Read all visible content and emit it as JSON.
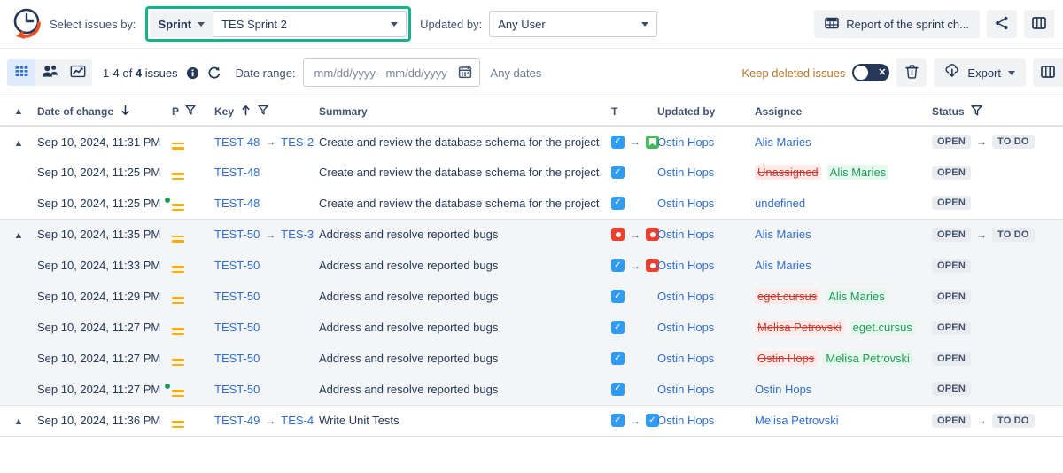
{
  "header": {
    "logo_icon": "clock-arrow-logo",
    "select_issues_label": "Select issues by:",
    "scope_segment": {
      "label": "Sprint",
      "icon": "chevron-down-icon"
    },
    "scope_value": {
      "value": "TES Sprint 2",
      "icon": "chevron-down-icon"
    },
    "updated_by_label": "Updated by:",
    "updated_by_value": {
      "value": "Any User",
      "icon": "chevron-down-icon"
    },
    "report_button": {
      "label": "Report of the sprint ch...",
      "icon": "table-grid-icon"
    },
    "share_button": {
      "icon": "share-icon"
    },
    "columns_button": {
      "icon": "columns-icon"
    },
    "highlight_color": "#16b28a"
  },
  "toolbar": {
    "views": [
      {
        "name": "grid-view",
        "icon": "grid-icon",
        "active": true
      },
      {
        "name": "people-view",
        "icon": "people-icon",
        "active": false
      },
      {
        "name": "chart-view",
        "icon": "chart-line-icon",
        "active": false
      }
    ],
    "count_prefix": "1-4",
    "count_middle": "of",
    "count_number": "4",
    "count_suffix": "issues",
    "info_icon": "info-icon",
    "refresh_icon": "refresh-icon",
    "date_range_label": "Date range:",
    "date_range_placeholder": "mm/dd/yyyy - mm/dd/yyyy",
    "calendar_icon": "calendar-icon",
    "any_dates_label": "Any dates",
    "keep_deleted_label": "Keep deleted issues",
    "keep_deleted_state": "off",
    "toggle_glyph": "✕",
    "trash_icon": "trash-icon",
    "export_button": {
      "label": "Export",
      "icon": "cloud-download-icon",
      "caret": "chevron-down-icon"
    },
    "columns_icon": "columns-icon"
  },
  "table": {
    "columns": [
      {
        "key": "expand",
        "label": "",
        "icon": "chevron-up-icon"
      },
      {
        "key": "date",
        "label": "Date of change",
        "sort_icon": "arrow-down-icon"
      },
      {
        "key": "priority",
        "label": "P",
        "filter_icon": "filter-icon"
      },
      {
        "key": "issuekey",
        "label": "Key",
        "sort_icon": "arrow-up-icon",
        "filter_icon": "filter-icon"
      },
      {
        "key": "summary",
        "label": "Summary"
      },
      {
        "key": "type",
        "label": "T"
      },
      {
        "key": "updated_by",
        "label": "Updated by"
      },
      {
        "key": "assignee",
        "label": "Assignee"
      },
      {
        "key": "status",
        "label": "Status",
        "filter_icon": "filter-icon"
      }
    ],
    "groups": [
      {
        "alt": false,
        "rows": [
          {
            "expandable": true,
            "date": "Sep 10, 2024, 11:31 PM",
            "dot": false,
            "priority": "medium",
            "key_from": "TEST-48",
            "key_to": "TES-2",
            "summary": "Create and review the database schema for the project",
            "type_from": "task",
            "type_to": "story",
            "updated_by": "Ostin Hops",
            "assignee_kind": "plain",
            "assignee": "Alis Maries",
            "status_from": "OPEN",
            "status_to": "TO DO"
          },
          {
            "expandable": false,
            "date": "Sep 10, 2024, 11:25 PM",
            "dot": false,
            "priority": "medium",
            "key_from": "TEST-48",
            "key_to": "",
            "summary": "Create and review the database schema for the project",
            "type_from": "task",
            "type_to": "",
            "updated_by": "Ostin Hops",
            "assignee_kind": "change",
            "assignee_old": "Unassigned",
            "assignee_new": "Alis Maries",
            "status_from": "OPEN",
            "status_to": ""
          },
          {
            "expandable": false,
            "date": "Sep 10, 2024, 11:25 PM",
            "dot": true,
            "priority": "medium",
            "key_from": "TEST-48",
            "key_to": "",
            "summary": "Create and review the database schema for the project",
            "type_from": "task",
            "type_to": "",
            "updated_by": "Ostin Hops",
            "assignee_kind": "link",
            "assignee": "undefined",
            "status_from": "OPEN",
            "status_to": ""
          }
        ]
      },
      {
        "alt": true,
        "rows": [
          {
            "expandable": true,
            "date": "Sep 10, 2024, 11:35 PM",
            "dot": false,
            "priority": "medium",
            "key_from": "TEST-50",
            "key_to": "TES-3",
            "summary": "Address and resolve reported bugs",
            "type_from": "bug",
            "type_to": "bug",
            "updated_by": "Ostin Hops",
            "assignee_kind": "plain",
            "assignee": "Alis Maries",
            "status_from": "OPEN",
            "status_to": "TO DO"
          },
          {
            "expandable": false,
            "date": "Sep 10, 2024, 11:33 PM",
            "dot": false,
            "priority": "medium",
            "key_from": "TEST-50",
            "key_to": "",
            "summary": "Address and resolve reported bugs",
            "type_from": "task",
            "type_to": "bug",
            "updated_by": "Ostin Hops",
            "assignee_kind": "plain",
            "assignee": "Alis Maries",
            "status_from": "OPEN",
            "status_to": ""
          },
          {
            "expandable": false,
            "date": "Sep 10, 2024, 11:29 PM",
            "dot": false,
            "priority": "medium",
            "key_from": "TEST-50",
            "key_to": "",
            "summary": "Address and resolve reported bugs",
            "type_from": "task",
            "type_to": "",
            "updated_by": "Ostin Hops",
            "assignee_kind": "change",
            "assignee_old": "eget.cursus",
            "assignee_new": "Alis Maries",
            "status_from": "OPEN",
            "status_to": ""
          },
          {
            "expandable": false,
            "date": "Sep 10, 2024, 11:27 PM",
            "dot": false,
            "priority": "medium",
            "key_from": "TEST-50",
            "key_to": "",
            "summary": "Address and resolve reported bugs",
            "type_from": "task",
            "type_to": "",
            "updated_by": "Ostin Hops",
            "assignee_kind": "change",
            "assignee_old": "Melisa Petrovski",
            "assignee_new": "eget.cursus",
            "status_from": "OPEN",
            "status_to": ""
          },
          {
            "expandable": false,
            "date": "Sep 10, 2024, 11:27 PM",
            "dot": false,
            "priority": "medium",
            "key_from": "TEST-50",
            "key_to": "",
            "summary": "Address and resolve reported bugs",
            "type_from": "task",
            "type_to": "",
            "updated_by": "Ostin Hops",
            "assignee_kind": "change",
            "assignee_old": "Ostin Hops",
            "assignee_new": "Melisa Petrovski",
            "status_from": "OPEN",
            "status_to": ""
          },
          {
            "expandable": false,
            "date": "Sep 10, 2024, 11:27 PM",
            "dot": true,
            "priority": "medium",
            "key_from": "TEST-50",
            "key_to": "",
            "summary": "Address and resolve reported bugs",
            "type_from": "task",
            "type_to": "",
            "updated_by": "Ostin Hops",
            "assignee_kind": "link",
            "assignee": "Ostin Hops",
            "status_from": "OPEN",
            "status_to": ""
          }
        ]
      },
      {
        "alt": false,
        "rows": [
          {
            "expandable": true,
            "date": "Sep 10, 2024, 11:36 PM",
            "dot": false,
            "priority": "medium",
            "key_from": "TEST-49",
            "key_to": "TES-4",
            "summary": "Write Unit Tests",
            "type_from": "task",
            "type_to": "task",
            "updated_by": "Ostin Hops",
            "assignee_kind": "plain",
            "assignee": "Melisa Petrovski",
            "status_from": "OPEN",
            "status_to": "TO DO"
          }
        ]
      }
    ]
  },
  "colors": {
    "accent_green": "#16b28a",
    "link_blue": "#2f6fd0",
    "priority_orange": "#ffab00",
    "task_blue": "#2f9bf2",
    "story_green": "#49b85b",
    "bug_red": "#f03e2f",
    "removed_red": "#cc3b2f",
    "added_green": "#1f9c5a"
  }
}
